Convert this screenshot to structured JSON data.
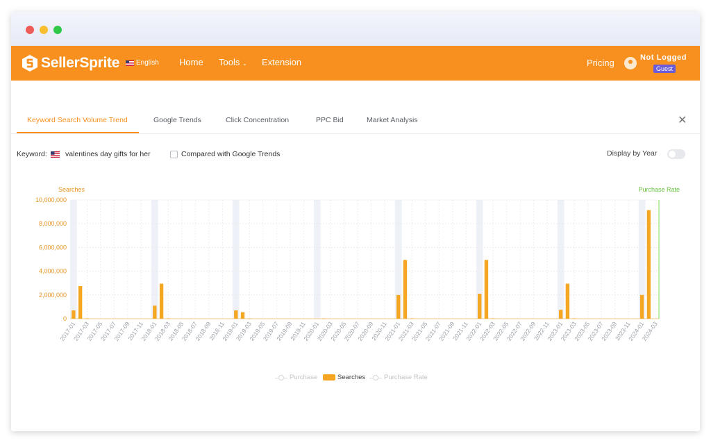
{
  "brand": {
    "name": "SellerSprite",
    "accent": "#f7901e"
  },
  "header": {
    "language": "English",
    "nav": [
      "Home",
      "Tools",
      "Extension"
    ],
    "pricing": "Pricing",
    "user": {
      "name": "Not Logged",
      "badge": "Guest"
    }
  },
  "tabs": [
    "Keyword Search Volume Trend",
    "Google Trends",
    "Click Concentration",
    "PPC Bid",
    "Market Analysis"
  ],
  "active_tab": 0,
  "controls": {
    "keyword_label": "Keyword:",
    "keyword": "valentines day gifts for her",
    "compare_label": "Compared with Google Trends",
    "compare_checked": false,
    "display_by_year_label": "Display by Year",
    "display_by_year": false
  },
  "chart_data": {
    "type": "bar",
    "left_axis_label": "Searches",
    "right_axis_label": "Purchase Rate",
    "ylim": [
      0,
      10000000
    ],
    "y_ticks": [
      "10,000,000",
      "8,000,000",
      "6,000,000",
      "4,000,000",
      "2,000,000",
      "0"
    ],
    "x_start": "2017-01",
    "x_end": "2024-03",
    "series": [
      {
        "name": "Searches",
        "color": "#f5a623",
        "values": [
          {
            "x": "2017-01",
            "y": 700000
          },
          {
            "x": "2017-02",
            "y": 2750000
          },
          {
            "x": "2017-03",
            "y": 25000
          },
          {
            "x": "2018-01",
            "y": 1100000
          },
          {
            "x": "2018-02",
            "y": 2950000
          },
          {
            "x": "2018-03",
            "y": 25000
          },
          {
            "x": "2019-01",
            "y": 700000
          },
          {
            "x": "2019-02",
            "y": 550000
          },
          {
            "x": "2019-03",
            "y": 20000
          },
          {
            "x": "2020-02",
            "y": 15000
          },
          {
            "x": "2021-01",
            "y": 2000000
          },
          {
            "x": "2021-02",
            "y": 4950000
          },
          {
            "x": "2021-03",
            "y": 30000
          },
          {
            "x": "2022-01",
            "y": 2100000
          },
          {
            "x": "2022-02",
            "y": 4950000
          },
          {
            "x": "2022-03",
            "y": 30000
          },
          {
            "x": "2023-01",
            "y": 750000
          },
          {
            "x": "2023-02",
            "y": 2950000
          },
          {
            "x": "2023-03",
            "y": 25000
          },
          {
            "x": "2024-01",
            "y": 2000000
          },
          {
            "x": "2024-02",
            "y": 9150000
          }
        ]
      }
    ],
    "legend": [
      "Purchase",
      "Searches",
      "Purchase Rate"
    ],
    "grid": true
  }
}
